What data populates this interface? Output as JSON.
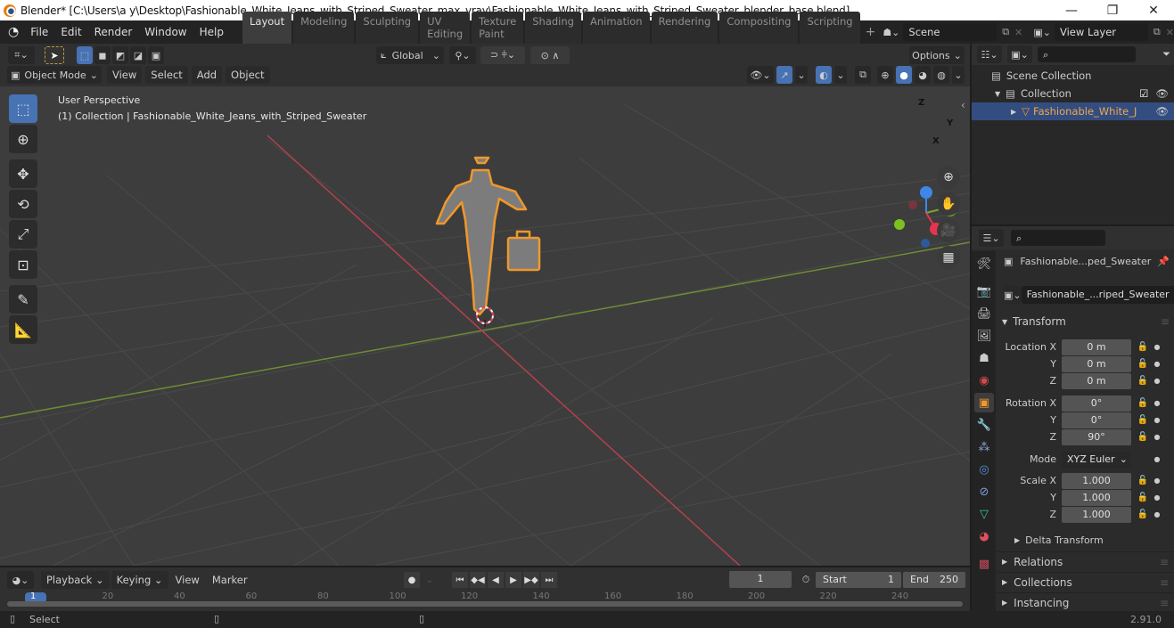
{
  "window": {
    "title": "Blender* [C:\\Users\\a y\\Desktop\\Fashionable_White_Jeans_with_Striped_Sweater_max_vray\\Fashionable_White_Jeans_with_Striped_Sweater_blender_base.blend]",
    "minimize": "—",
    "maximize": "❐",
    "close": "✕"
  },
  "menu": [
    "File",
    "Edit",
    "Render",
    "Window",
    "Help"
  ],
  "workspaces": [
    "Layout",
    "Modeling",
    "Sculpting",
    "UV Editing",
    "Texture Paint",
    "Shading",
    "Animation",
    "Rendering",
    "Compositing",
    "Scripting"
  ],
  "active_workspace": "Layout",
  "add_workspace": "+",
  "scene": {
    "label": "Scene"
  },
  "view_layer": {
    "label": "View Layer"
  },
  "viewport_header": {
    "transform_orientation": "Global",
    "options": "Options",
    "mode": "Object Mode",
    "menus": [
      "View",
      "Select",
      "Add",
      "Object"
    ]
  },
  "viewport": {
    "perspective": "User Perspective",
    "collection_info": "(1) Collection | Fashionable_White_Jeans_with_Striped_Sweater",
    "gizmo_axes": {
      "x": "X",
      "y": "Y",
      "z": "Z"
    },
    "colors": {
      "x_axis": "#e8344f",
      "y_axis": "#7ea32d",
      "z_axis": "#3f86e8",
      "selection": "#f0982b"
    }
  },
  "outliner": {
    "scene_collection": "Scene Collection",
    "collection": "Collection",
    "object": "Fashionable_White_J"
  },
  "properties": {
    "object_name": "Fashionable...ped_Sweater",
    "object_datablock": "Fashionable_...riped_Sweater",
    "transform_label": "Transform",
    "location": {
      "label": "Location X",
      "x": "0 m",
      "y": "0 m",
      "z": "0 m"
    },
    "rotation": {
      "label": "Rotation X",
      "x": "0°",
      "y": "0°",
      "z": "90°"
    },
    "mode": {
      "label": "Mode",
      "value": "XYZ Euler"
    },
    "scale": {
      "label": "Scale X",
      "x": "1.000",
      "y": "1.000",
      "z": "1.000"
    },
    "axis_y": "Y",
    "axis_z": "Z",
    "delta_transform": "Delta Transform",
    "sections": [
      "Relations",
      "Collections",
      "Instancing"
    ]
  },
  "timeline": {
    "editor_menus": [
      "Playback",
      "Keying",
      "View",
      "Marker"
    ],
    "current_frame": "1",
    "start_label": "Start",
    "start": "1",
    "end_label": "End",
    "end": "250",
    "ruler": [
      "1",
      "20",
      "40",
      "60",
      "80",
      "100",
      "120",
      "140",
      "160",
      "180",
      "200",
      "220",
      "240"
    ]
  },
  "status": {
    "select": "Select",
    "version": "2.91.0"
  }
}
